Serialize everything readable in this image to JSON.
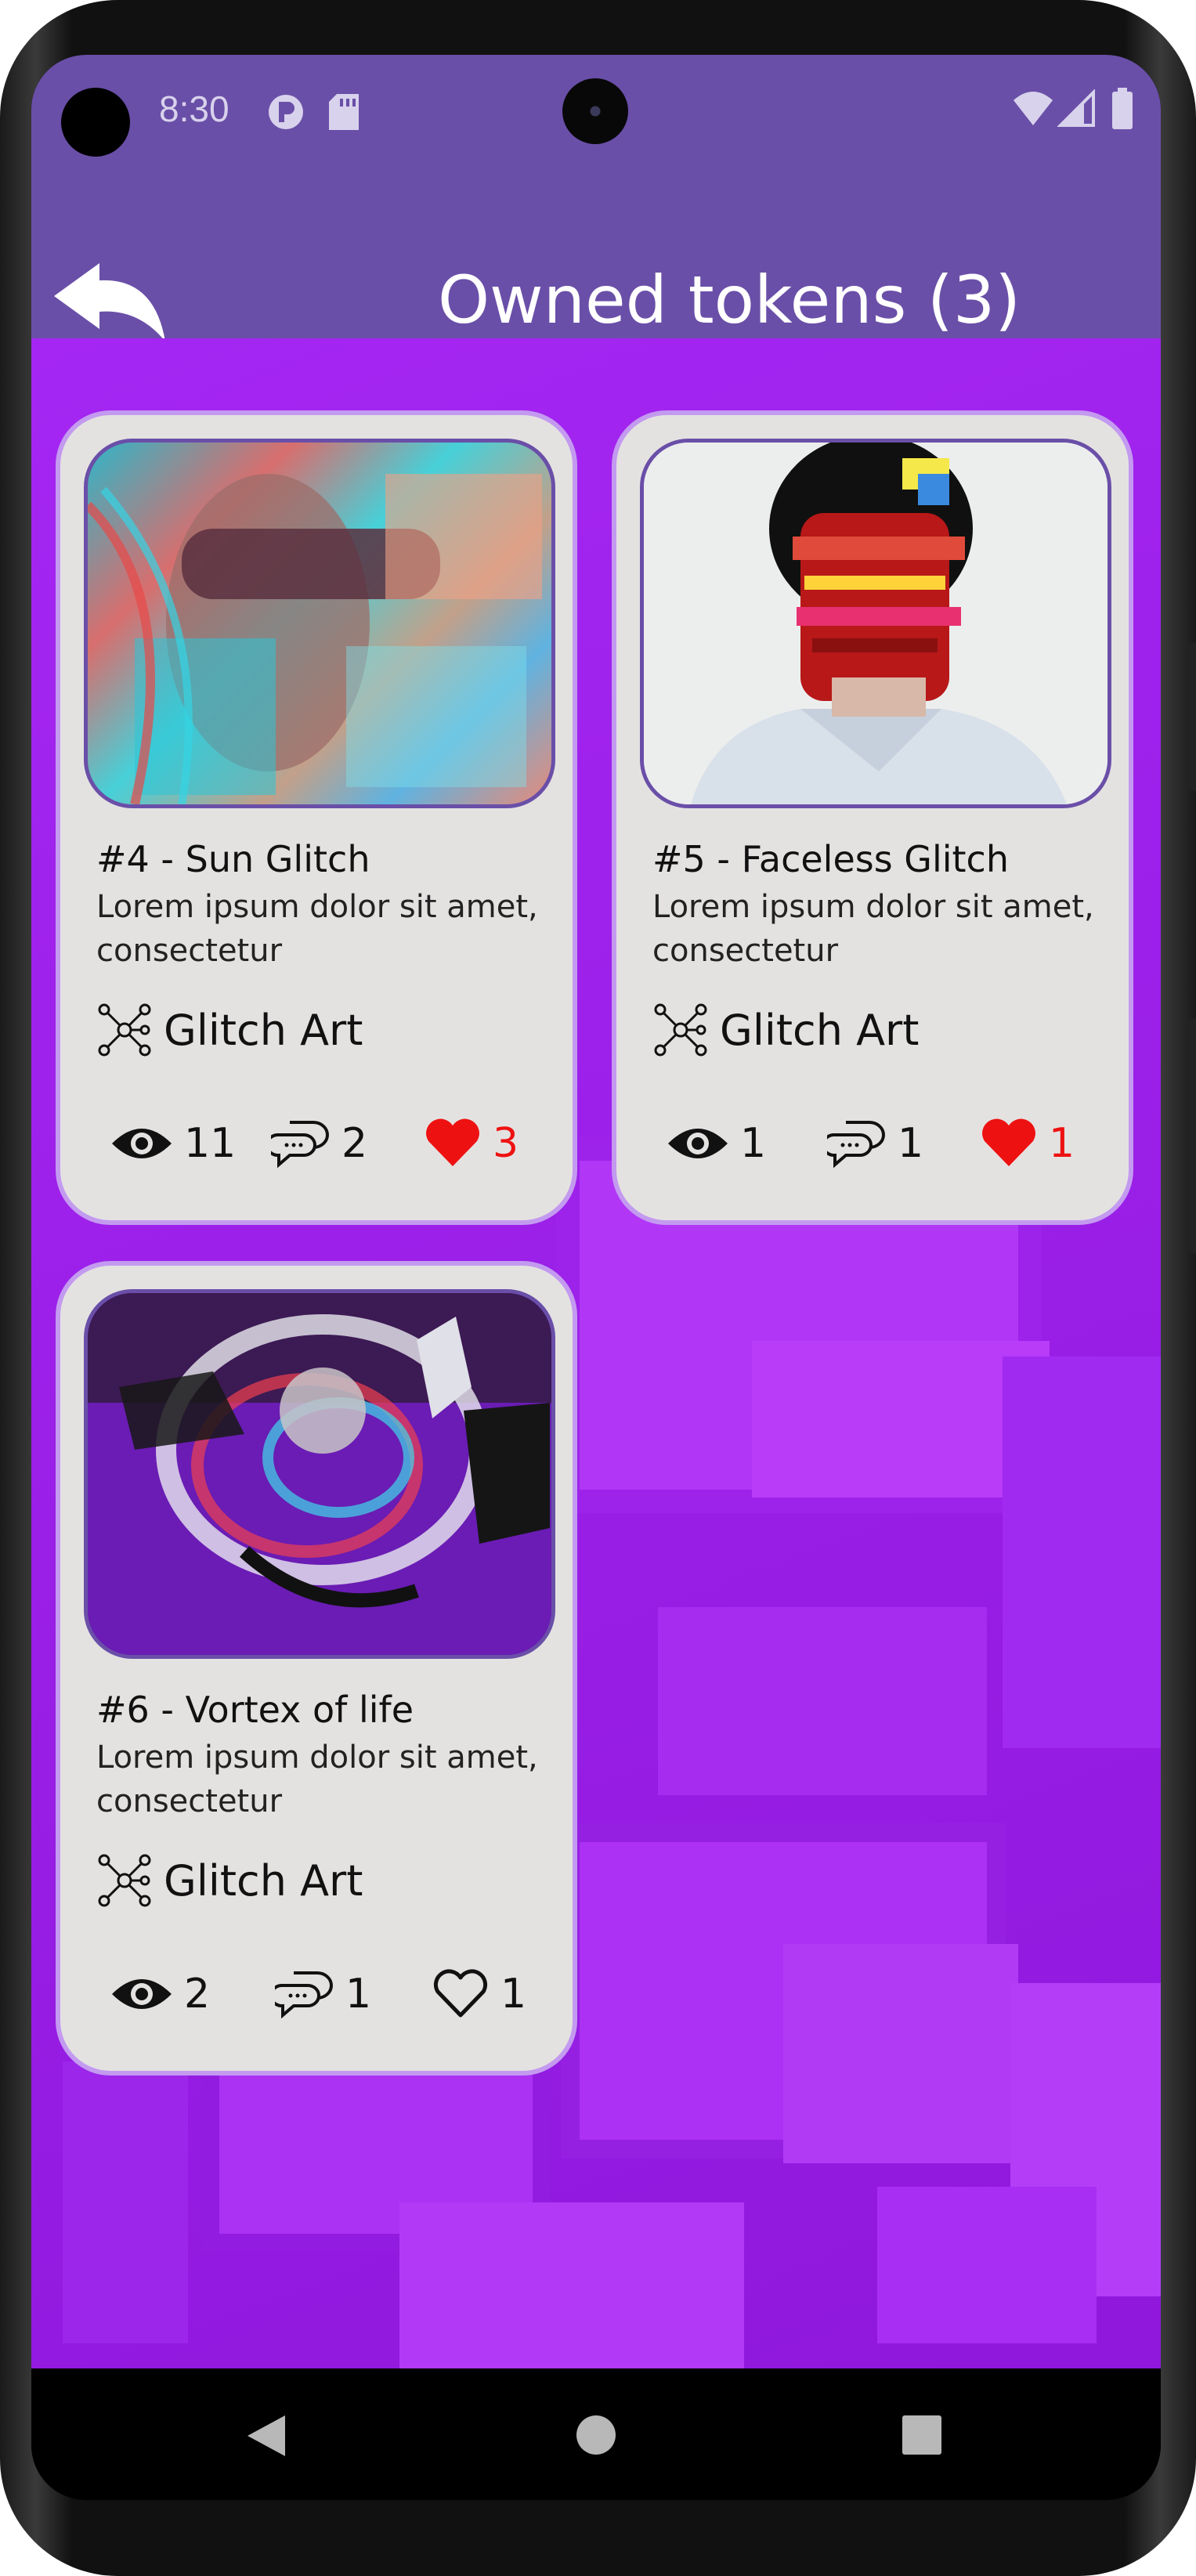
{
  "status_bar": {
    "time": "8:30"
  },
  "app_bar": {
    "title": "Owned tokens (3)",
    "back_icon": "reply-arrow-icon"
  },
  "tokens": [
    {
      "title": "#4 - Sun Glitch",
      "description": "Lorem ipsum dolor sit amet, consectetur",
      "category": "Glitch Art",
      "views": "11",
      "comments": "2",
      "likes": "3",
      "liked": true
    },
    {
      "title": "#5 - Faceless Glitch",
      "description": "Lorem ipsum dolor sit amet, consectetur",
      "category": "Glitch Art",
      "views": "1",
      "comments": "1",
      "likes": "1",
      "liked": true
    },
    {
      "title": "#6 - Vortex of life",
      "description": "Lorem ipsum dolor sit amet, consectetur",
      "category": "Glitch Art",
      "views": "2",
      "comments": "1",
      "likes": "1",
      "liked": false
    }
  ],
  "nav_bar": {
    "back": "back-triangle-icon",
    "home": "home-circle-icon",
    "recents": "recents-square-icon"
  },
  "colors": {
    "app_bar": "#6a4fa8",
    "background": "#9a1fe6",
    "card": "#e4e2e1",
    "card_border": "#c39af0",
    "like_active": "#ee1111"
  }
}
